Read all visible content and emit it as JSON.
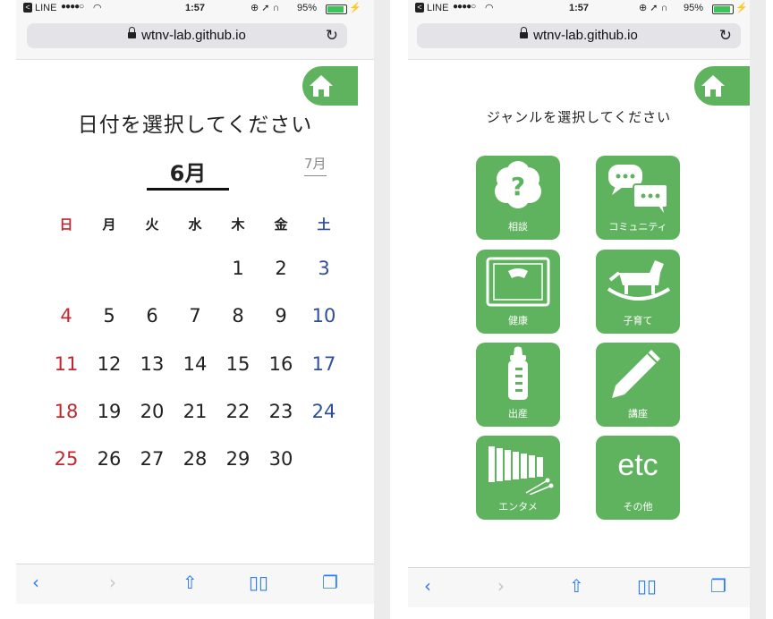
{
  "status": {
    "carrier": "LINE",
    "time": "1:57",
    "battery": "95%"
  },
  "browser": {
    "url": "wtnv-lab.github.io"
  },
  "calendar": {
    "title": "日付を選択してください",
    "current_month": "6月",
    "next_month": "7月",
    "weekdays": [
      "日",
      "月",
      "火",
      "水",
      "木",
      "金",
      "土"
    ],
    "weeks": [
      [
        "",
        "",
        "",
        "",
        "1",
        "2",
        "3"
      ],
      [
        "4",
        "5",
        "6",
        "7",
        "8",
        "9",
        "10"
      ],
      [
        "11",
        "12",
        "13",
        "14",
        "15",
        "16",
        "17"
      ],
      [
        "18",
        "19",
        "20",
        "21",
        "22",
        "23",
        "24"
      ],
      [
        "25",
        "26",
        "27",
        "28",
        "29",
        "30",
        ""
      ]
    ],
    "sunday_color": "#c1272d",
    "saturday_color": "#2d4f9e"
  },
  "genre": {
    "title": "ジャンルを選択してください",
    "tiles": [
      {
        "label": "相談",
        "icon": "question-cloud-icon"
      },
      {
        "label": "コミュニティ",
        "icon": "chat-bubbles-icon"
      },
      {
        "label": "健康",
        "icon": "scale-icon"
      },
      {
        "label": "子育て",
        "icon": "rocking-horse-icon"
      },
      {
        "label": "出産",
        "icon": "baby-bottle-icon"
      },
      {
        "label": "講座",
        "icon": "pencil-icon"
      },
      {
        "label": "エンタメ",
        "icon": "xylophone-icon"
      },
      {
        "label": "その他",
        "icon": "etc-icon",
        "icon_text": "etc"
      }
    ],
    "accent": "#5fb35f"
  }
}
